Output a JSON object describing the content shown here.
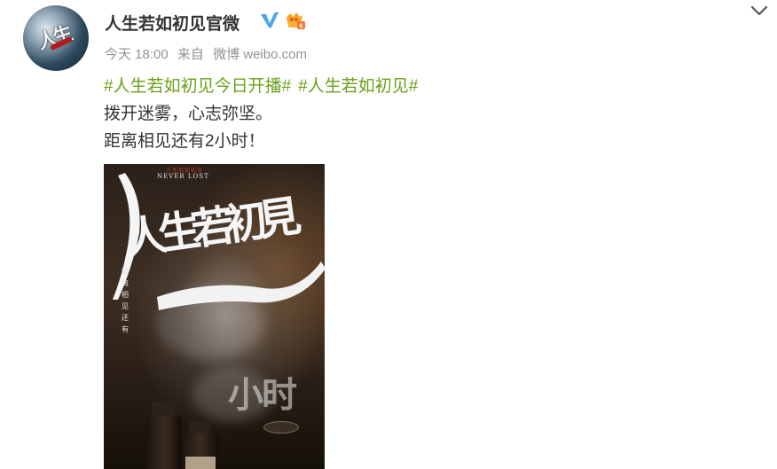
{
  "post": {
    "username": "人生若如初见官微",
    "time": "今天 18:00",
    "source_prefix": "来自",
    "source": "微博 weibo.com",
    "topics": [
      "#人生若如初见今日开播#",
      "#人生若如初见#"
    ],
    "line1": "拨开迷雾，心志弥坚。",
    "line2": "距离相见还有2小时！"
  },
  "poster": {
    "top_red": "人生若如初见",
    "top_en": "NEVER LOST",
    "title": "人生若初見",
    "vertical": "距离相见还有",
    "hours": "小时"
  },
  "icons": {
    "verify": "verified-v-icon",
    "vip": "vip-badge-icon",
    "menu": "chevron-down-icon"
  },
  "colors": {
    "topic": "#6aa01a",
    "verify": "#4ea8e6",
    "meta": "#939393",
    "text": "#333333"
  }
}
